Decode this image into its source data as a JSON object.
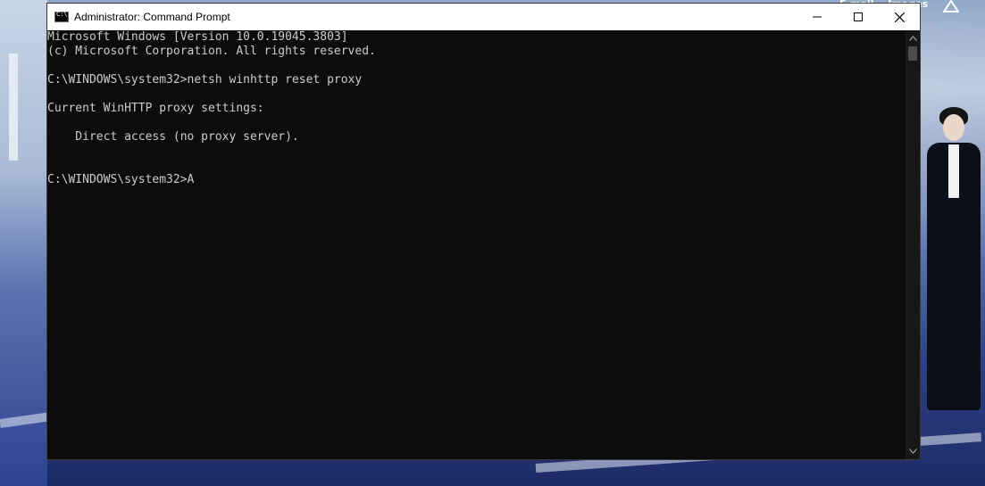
{
  "window": {
    "title": "Administrator: Command Prompt"
  },
  "console": {
    "lines": [
      "Microsoft Windows [Version 10.0.19045.3803]",
      "(c) Microsoft Corporation. All rights reserved.",
      "",
      "C:\\WINDOWS\\system32>netsh winhttp reset proxy",
      "",
      "Current WinHTTP proxy settings:",
      "",
      "    Direct access (no proxy server).",
      "",
      "",
      "C:\\WINDOWS\\system32>A"
    ]
  },
  "desktop": {
    "hint_left": "E-mail",
    "hint_right": "Images"
  },
  "colors": {
    "console_bg": "#0c0c0c",
    "console_text": "#cccccc",
    "titlebar_bg": "#ffffff"
  },
  "icons": {
    "app": "cmd-icon",
    "minimize": "minimize-icon",
    "maximize": "maximize-icon",
    "close": "close-icon",
    "scroll_up": "chevron-up-icon",
    "scroll_down": "chevron-down-icon"
  }
}
